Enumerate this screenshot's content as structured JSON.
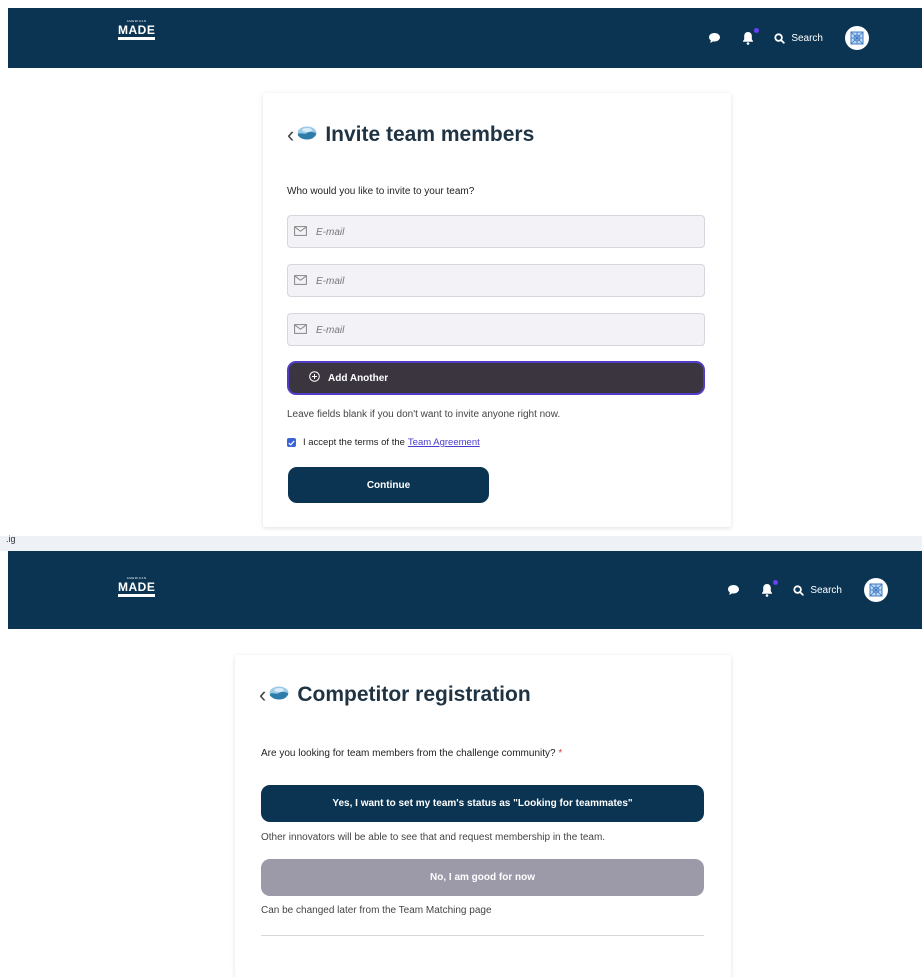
{
  "logo": {
    "line_top": "AMERICAN",
    "line_main": "MADE",
    "line_sub": "CHALLENGES"
  },
  "header": {
    "search_label": "Search"
  },
  "colors": {
    "header_bg": "#0b3452",
    "accent": "#4f3dc6",
    "secondary_button": "#9c99a8"
  },
  "screen1": {
    "title": "Invite team members",
    "question": "Who would you like to invite to your team?",
    "email_fields": [
      {
        "placeholder": "E-mail"
      },
      {
        "placeholder": "E-mail"
      },
      {
        "placeholder": "E-mail"
      }
    ],
    "add_another_label": "Add Another",
    "hint": "Leave fields blank if you don't want to invite anyone right now.",
    "terms_text": "I accept the terms of the",
    "terms_link": "Team Agreement",
    "terms_checked": true,
    "continue_label": "Continue"
  },
  "strip_text": ".ig",
  "screen2": {
    "title": "Competitor registration",
    "question": "Are you looking for team members from the challenge community?",
    "required_mark": "*",
    "yes_label": "Yes, I want to set my team's status as \"Looking for teammates\"",
    "yes_note": "Other innovators will be able to see that and request membership in the team.",
    "no_label": "No, I am good for now",
    "no_note": "Can be changed later from the Team Matching page"
  }
}
